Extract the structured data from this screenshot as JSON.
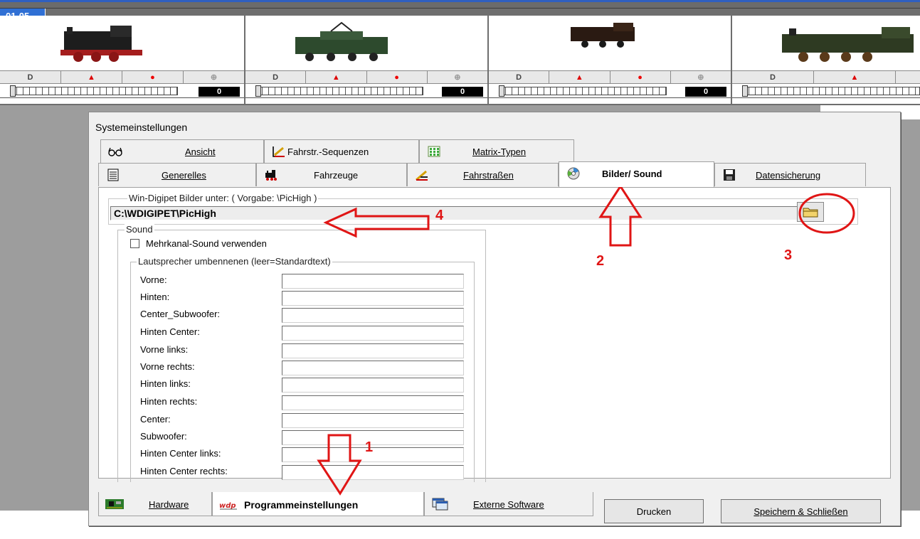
{
  "header": {
    "tag": "01-05"
  },
  "locos": [
    {
      "speed": "0"
    },
    {
      "speed": "0"
    },
    {
      "speed": "0"
    },
    {
      "speed": "0"
    }
  ],
  "loco_buttons": {
    "light": "D",
    "direction": "▲",
    "stop": "●",
    "sound": "⊕"
  },
  "dialog": {
    "title": "Systemeinstellungen",
    "tabs_row1": [
      {
        "label": "Ansicht"
      },
      {
        "label": "Fahrstr.-Sequenzen"
      },
      {
        "label": "Matrix-Typen"
      }
    ],
    "tabs_row2": [
      {
        "label": "Generelles"
      },
      {
        "label": "Fahrzeuge"
      },
      {
        "label": "Fahrstraßen"
      },
      {
        "label": "Bilder/ Sound"
      },
      {
        "label": "Datensicherung"
      }
    ],
    "pictures_group": {
      "label": "Win-Digipet Bilder unter:   ( Vorgabe: \\PicHigh )",
      "path_value": "C:\\WDIGIPET\\PicHigh"
    },
    "sound_group": {
      "label": "Sound",
      "multichannel_label": "Mehrkanal-Sound verwenden",
      "speakers_label": "Lautsprecher umbennenen (leer=Standardtext)",
      "speakers": [
        {
          "label": "Vorne:",
          "value": ""
        },
        {
          "label": "Hinten:",
          "value": ""
        },
        {
          "label": "Center_Subwoofer:",
          "value": ""
        },
        {
          "label": "Hinten Center:",
          "value": ""
        },
        {
          "label": "Vorne links:",
          "value": ""
        },
        {
          "label": "Vorne rechts:",
          "value": ""
        },
        {
          "label": "Hinten links:",
          "value": ""
        },
        {
          "label": "Hinten rechts:",
          "value": ""
        },
        {
          "label": "Center:",
          "value": ""
        },
        {
          "label": "Subwoofer:",
          "value": ""
        },
        {
          "label": "Hinten Center links:",
          "value": ""
        },
        {
          "label": "Hinten Center rechts:",
          "value": ""
        }
      ]
    },
    "bottom_tabs": [
      {
        "label": "Hardware"
      },
      {
        "label": "Programmeinstellungen"
      },
      {
        "label": "Externe Software"
      }
    ],
    "buttons": {
      "print": "Drucken",
      "save_close": "Speichern & Schließen"
    }
  },
  "annotations": [
    "1",
    "2",
    "3",
    "4"
  ],
  "colors": {
    "annotation": "#e01515",
    "header_blue": "#2f6fd4"
  }
}
